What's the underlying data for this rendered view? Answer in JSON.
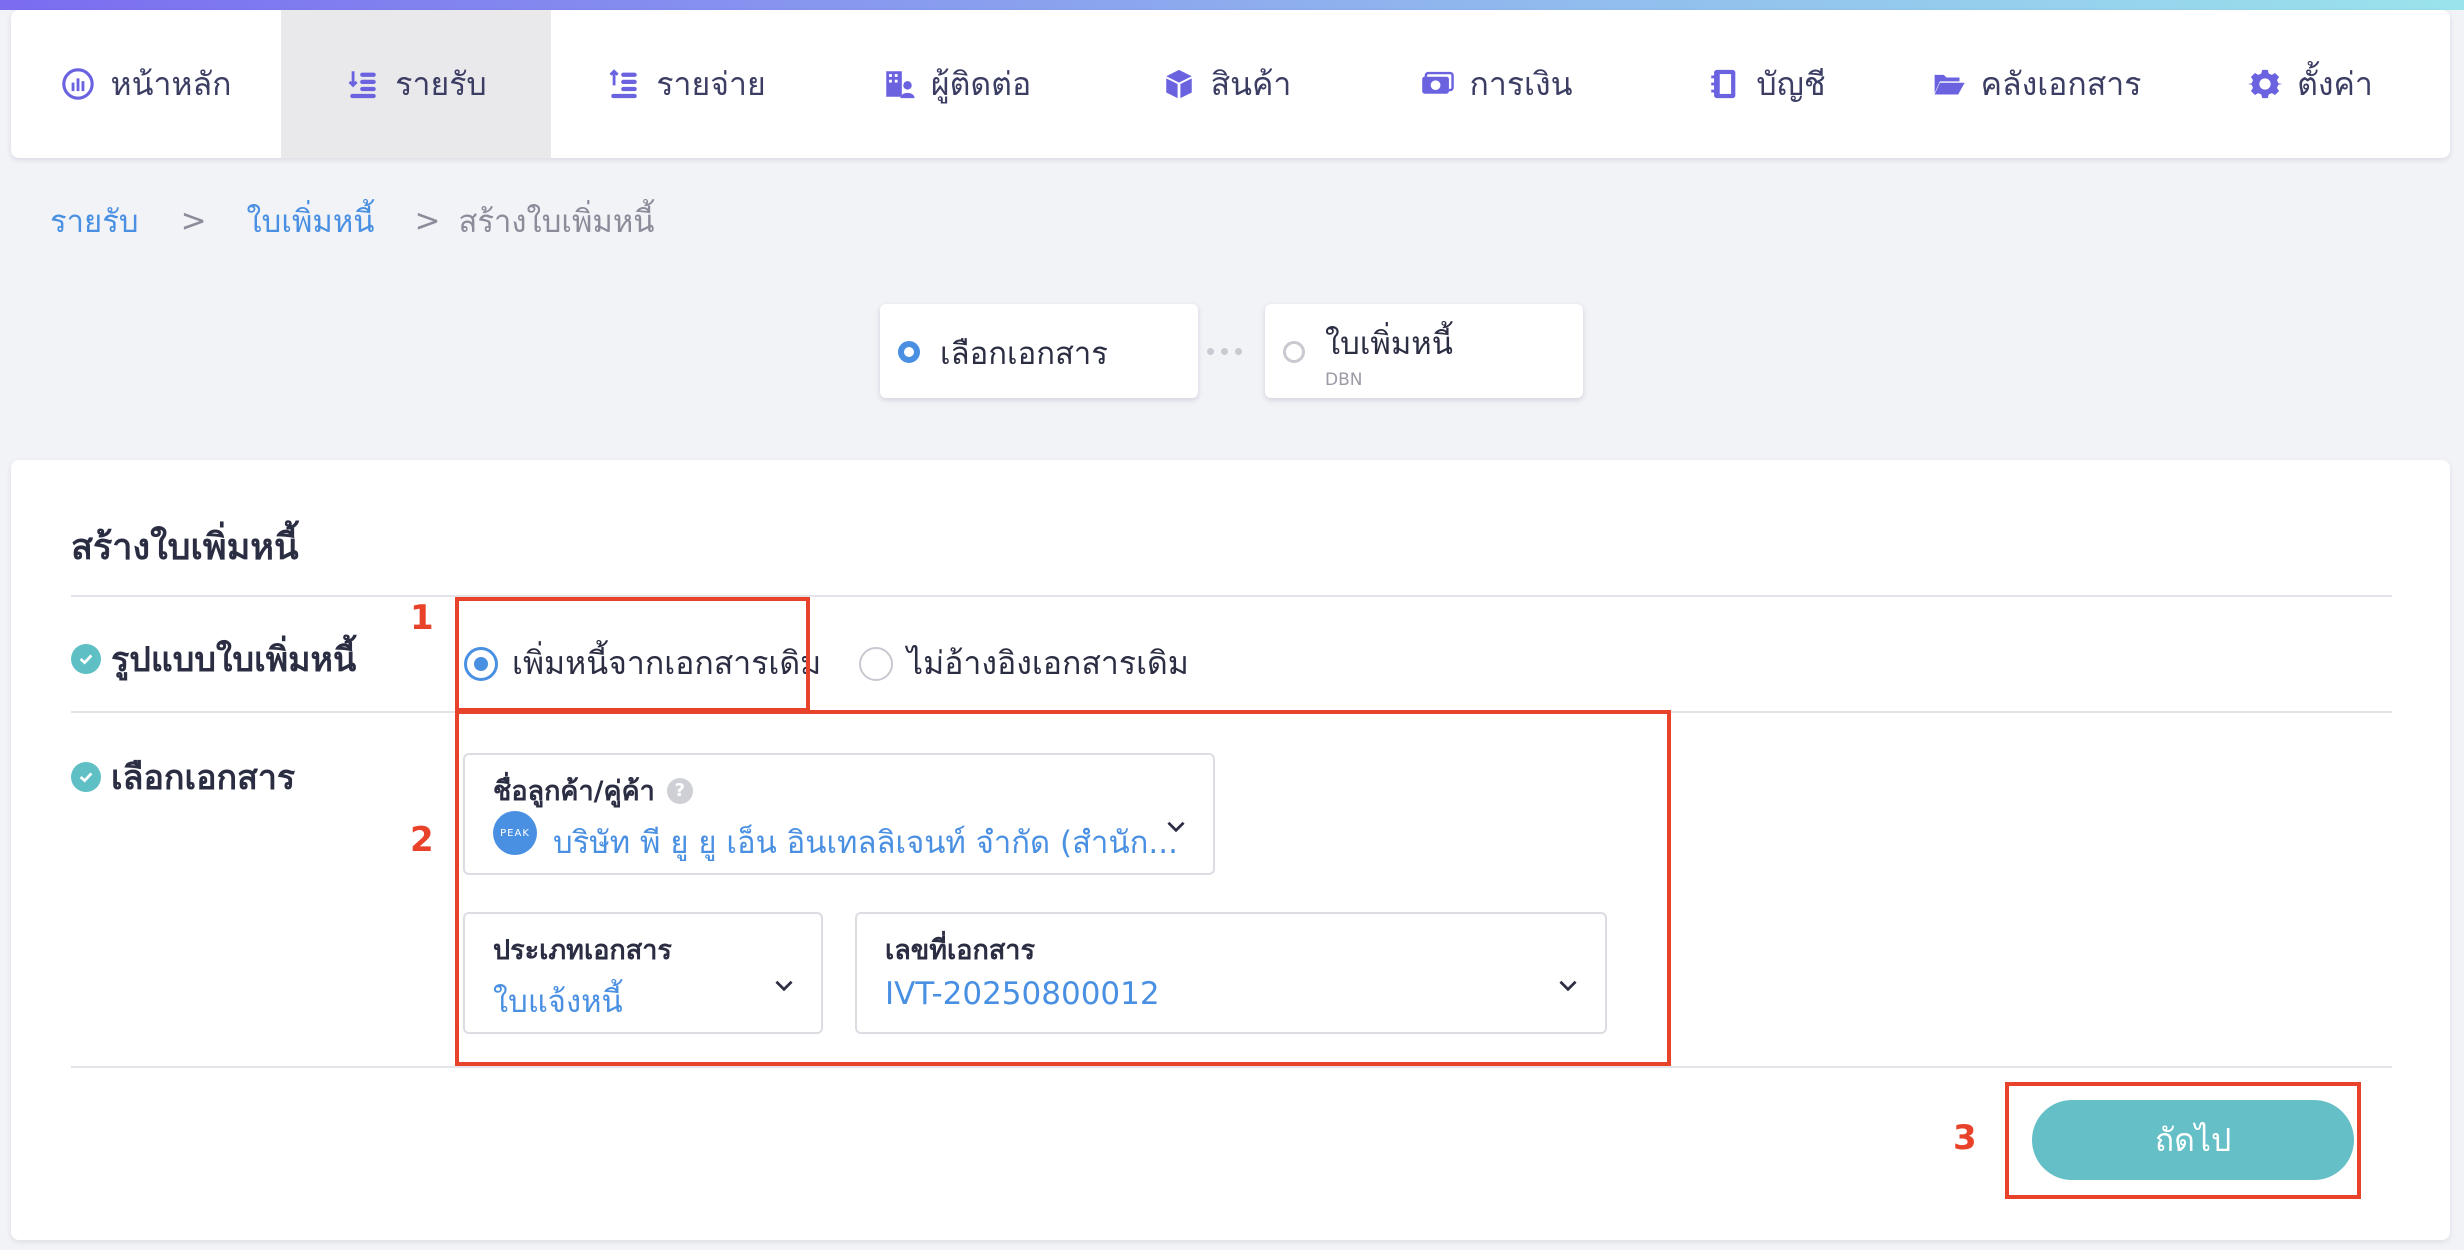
{
  "nav": {
    "items": [
      {
        "label": "หน้าหลัก",
        "icon": "dashboard-icon"
      },
      {
        "label": "รายรับ",
        "icon": "income-coins-icon",
        "active": true
      },
      {
        "label": "รายจ่าย",
        "icon": "expense-coins-icon"
      },
      {
        "label": "ผู้ติดต่อ",
        "icon": "contacts-building-icon"
      },
      {
        "label": "สินค้า",
        "icon": "product-box-icon"
      },
      {
        "label": "การเงิน",
        "icon": "money-bill-icon"
      },
      {
        "label": "บัญชี",
        "icon": "account-book-icon"
      },
      {
        "label": "คลังเอกสาร",
        "icon": "folder-icon"
      },
      {
        "label": "ตั้งค่า",
        "icon": "gear-icon"
      }
    ]
  },
  "breadcrumb": {
    "items": [
      "รายรับ",
      "ใบเพิ่มหนี้"
    ],
    "separator": ">",
    "current": "สร้างใบเพิ่มหนี้"
  },
  "steps": [
    {
      "label": "เลือกเอกสาร",
      "sub": "",
      "active": true
    },
    {
      "label": "ใบเพิ่มหนี้",
      "sub": "DBN",
      "active": false
    }
  ],
  "form": {
    "title": "สร้างใบเพิ่มหนี้",
    "format": {
      "label": "รูปแบบใบเพิ่มหนี้",
      "options": [
        {
          "label": "เพิ่มหนี้จากเอกสารเดิม",
          "selected": true
        },
        {
          "label": "ไม่อ้างอิงเอกสารเดิม",
          "selected": false
        }
      ]
    },
    "document": {
      "label": "เลือกเอกสาร",
      "customer": {
        "label": "ชื่อลูกค้า/คู่ค้า",
        "help": "?",
        "avatar": "PEAK",
        "value": "บริษัท พี ยู ยู เอ็น อินเทลลิเจนท์ จำกัด (สำนัก..."
      },
      "doc_type": {
        "label": "ประเภทเอกสาร",
        "value": "ใบแจ้งหนี้"
      },
      "doc_number": {
        "label": "เลขที่เอกสาร",
        "value": "IVT-20250800012"
      }
    },
    "next_label": "ถัดไป"
  },
  "annotations": [
    "1",
    "2",
    "3"
  ],
  "colors": {
    "accent": "#4a90e2",
    "teal": "#64bfc6",
    "annotation": "#e8432a"
  }
}
